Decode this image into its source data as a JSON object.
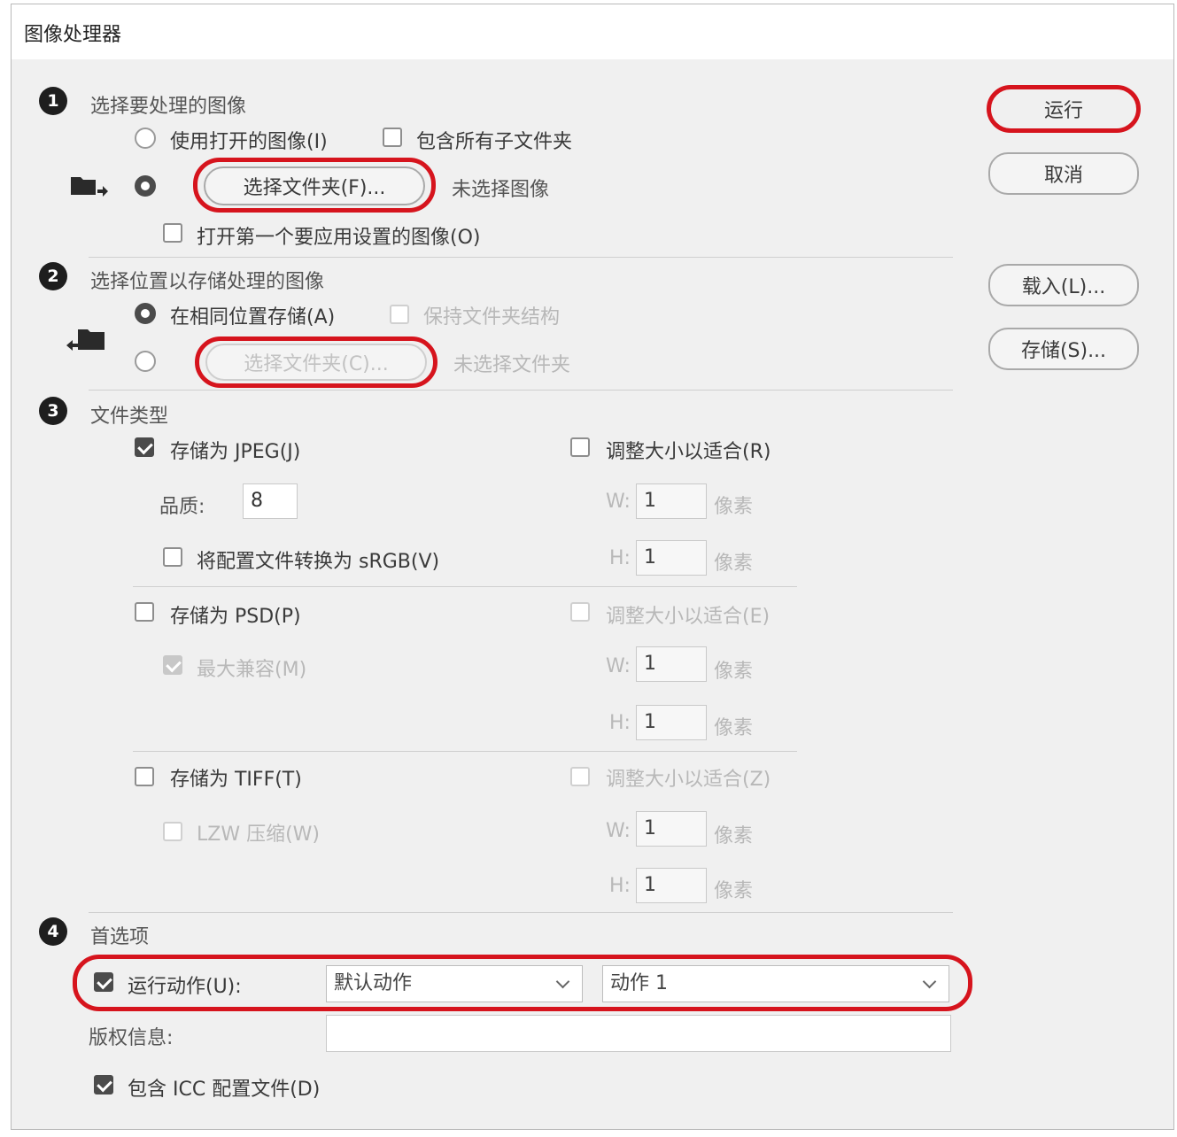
{
  "window": {
    "title": "图像处理器"
  },
  "buttons": {
    "run": "运行",
    "cancel": "取消",
    "load": "载入(L)...",
    "save": "存储(S)..."
  },
  "section1": {
    "number": "1",
    "title": "选择要处理的图像",
    "use_open": "使用打开的图像(I)",
    "include_subfolders": "包含所有子文件夹",
    "select_folder": "选择文件夹(F)...",
    "no_image": "未选择图像",
    "open_first": "打开第一个要应用设置的图像(O)"
  },
  "section2": {
    "number": "2",
    "title": "选择位置以存储处理的图像",
    "same_location": "在相同位置存储(A)",
    "keep_structure": "保持文件夹结构",
    "select_folder": "选择文件夹(C)...",
    "no_folder": "未选择文件夹"
  },
  "section3": {
    "number": "3",
    "title": "文件类型",
    "jpeg": {
      "save_as": "存储为 JPEG(J)",
      "resize": "调整大小以适合(R)",
      "quality_label": "品质:",
      "quality_value": "8",
      "convert_srgb": "将配置文件转换为 sRGB(V)",
      "w_label": "W:",
      "w_value": "1",
      "w_unit": "像素",
      "h_label": "H:",
      "h_value": "1",
      "h_unit": "像素"
    },
    "psd": {
      "save_as": "存储为 PSD(P)",
      "resize": "调整大小以适合(E)",
      "max_compat": "最大兼容(M)",
      "w_label": "W:",
      "w_value": "1",
      "w_unit": "像素",
      "h_label": "H:",
      "h_value": "1",
      "h_unit": "像素"
    },
    "tiff": {
      "save_as": "存储为 TIFF(T)",
      "resize": "调整大小以适合(Z)",
      "lzw": "LZW 压缩(W)",
      "w_label": "W:",
      "w_value": "1",
      "w_unit": "像素",
      "h_label": "H:",
      "h_value": "1",
      "h_unit": "像素"
    }
  },
  "section4": {
    "number": "4",
    "title": "首选项",
    "run_action": "运行动作(U):",
    "action_set": "默认动作",
    "action": "动作 1",
    "copyright_label": "版权信息:",
    "copyright_value": "",
    "include_icc": "包含 ICC 配置文件(D)"
  },
  "colors": {
    "highlight": "#d6141d"
  }
}
